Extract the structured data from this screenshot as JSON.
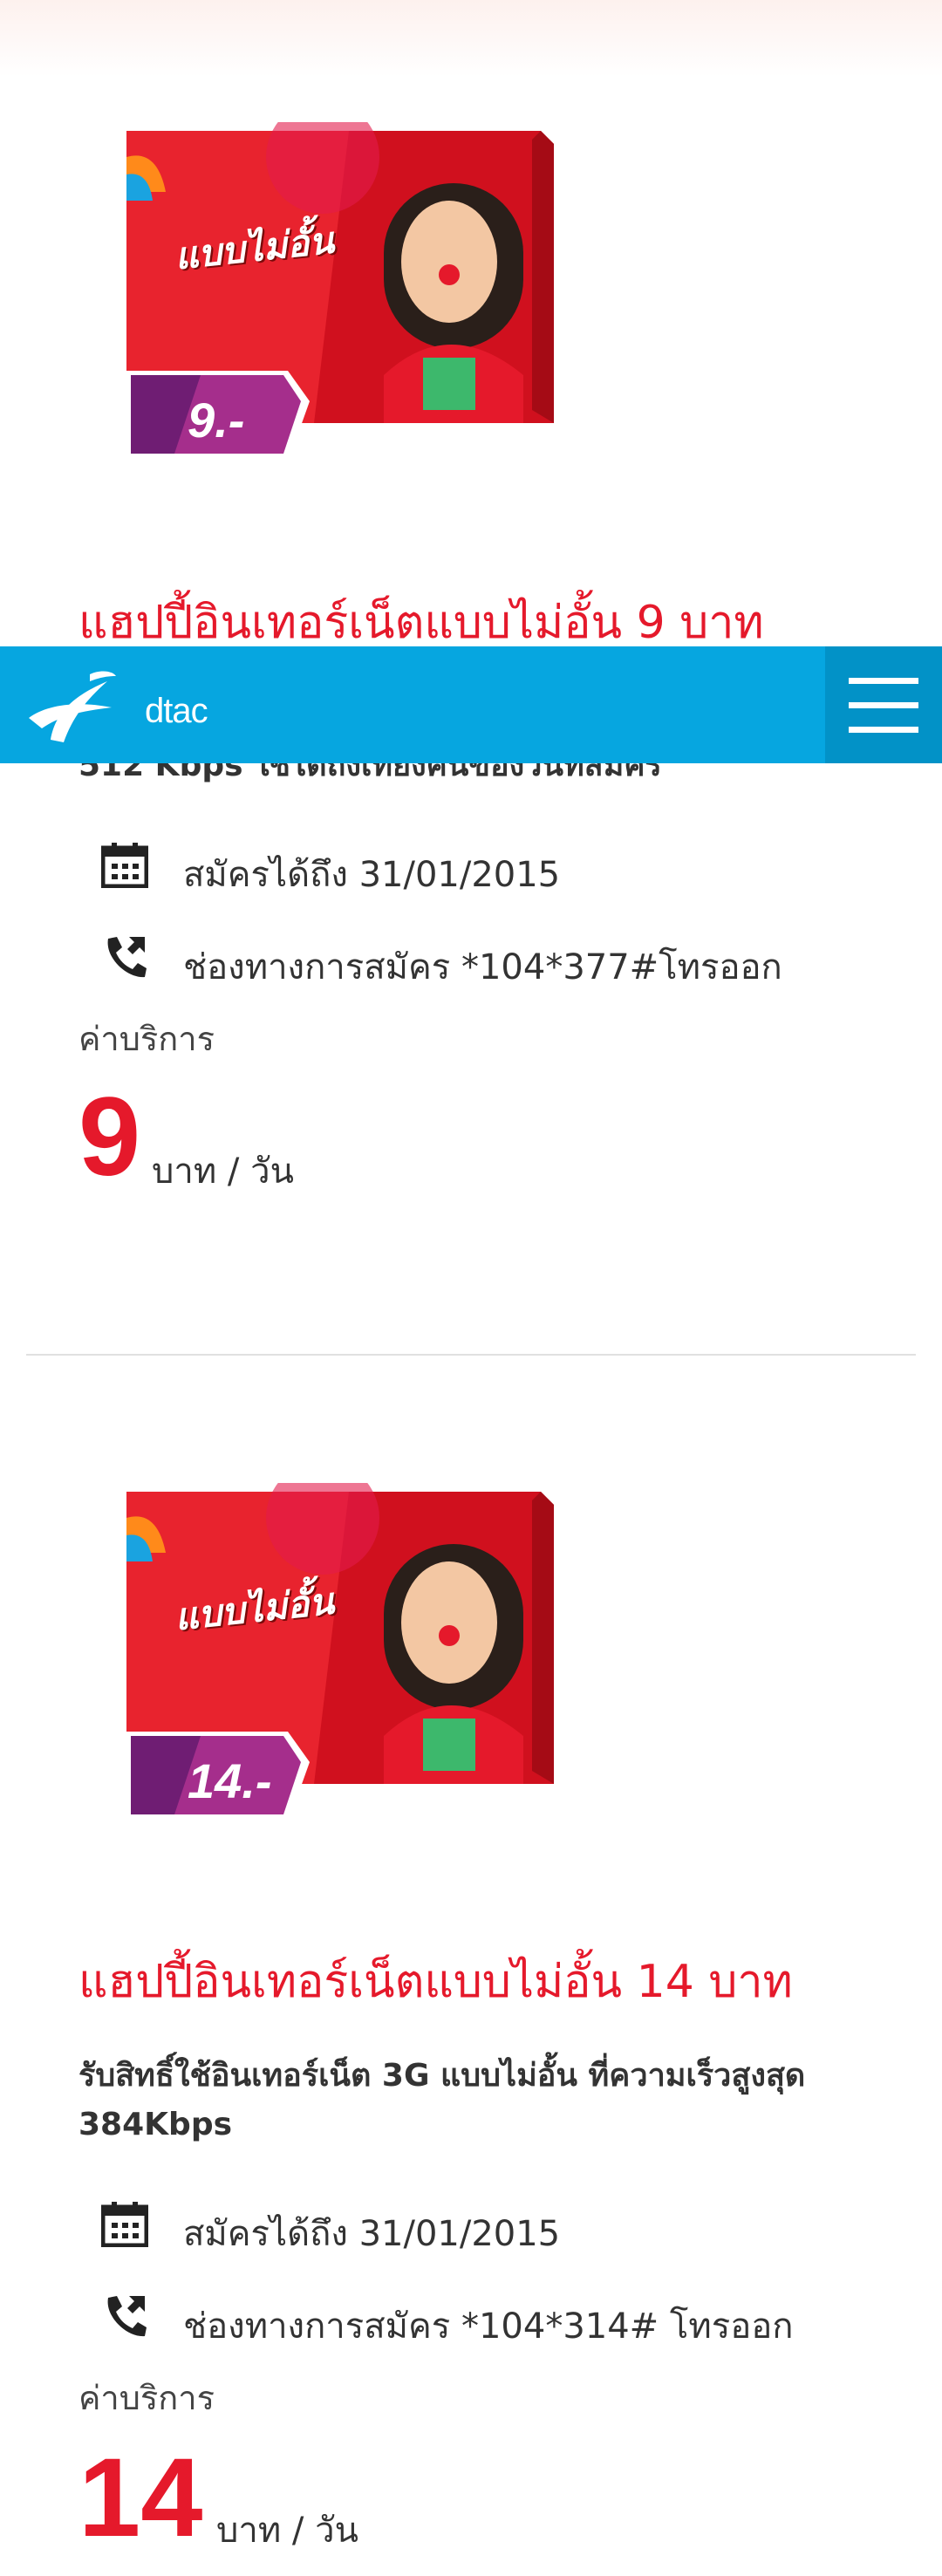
{
  "header": {
    "logo_text": "dtac",
    "menu_icon": "hamburger-icon",
    "colors": {
      "bar": "#06a6e0",
      "menu_bg": "#0292c7"
    }
  },
  "accent_color": "#e5192b",
  "products": [
    {
      "package_label": "แบบไม่อั้น",
      "package_price": "9.-",
      "title": "แฮปปี้อินเทอร์เน็ตแบบไม่อั้น 9 บาท",
      "description": "512 Kbps ใช้ได้ถึงเที่ยงคืนของวันที่สมัคร",
      "apply_until": "สมัครได้ถึง 31/01/2015",
      "channel": "ช่องทางการสมัคร *104*377#โทรออก",
      "fee_label": "ค่าบริการ",
      "price": "9",
      "price_unit": "บาท / วัน"
    },
    {
      "package_label": "แบบไม่อั้น",
      "package_price": "14.-",
      "title": "แฮปปี้อินเทอร์เน็ตแบบไม่อั้น 14 บาท",
      "description": "รับสิทธิ์ใช้อินเทอร์เน็ต 3G แบบไม่อั้น ที่ความเร็วสูงสุด 384Kbps",
      "apply_until": "สมัครได้ถึง 31/01/2015",
      "channel": "ช่องทางการสมัคร *104*314# โทรออก",
      "fee_label": "ค่าบริการ",
      "price": "14",
      "price_unit": "บาท / วัน"
    }
  ]
}
